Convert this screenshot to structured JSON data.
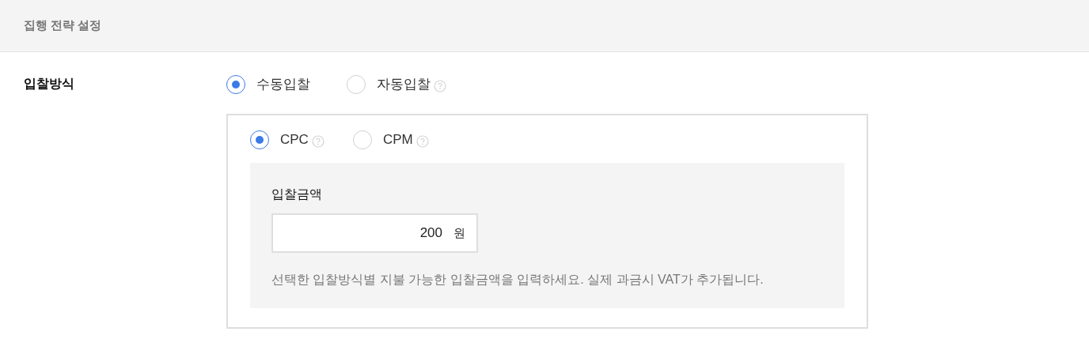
{
  "header": {
    "title": "집행 전략 설정"
  },
  "bid_method": {
    "label": "입찰방식",
    "options": [
      {
        "label": "수동입찰",
        "selected": true,
        "help": false
      },
      {
        "label": "자동입찰",
        "selected": false,
        "help": true
      }
    ],
    "bid_types": [
      {
        "label": "CPC",
        "selected": true,
        "help": true
      },
      {
        "label": "CPM",
        "selected": false,
        "help": true
      }
    ],
    "amount": {
      "label": "입찰금액",
      "value": "200",
      "unit": "원",
      "hint": "선택한 입찰방식별 지불 가능한 입찰금액을 입력하세요. 실제 과금시 VAT가 추가됩니다."
    }
  }
}
